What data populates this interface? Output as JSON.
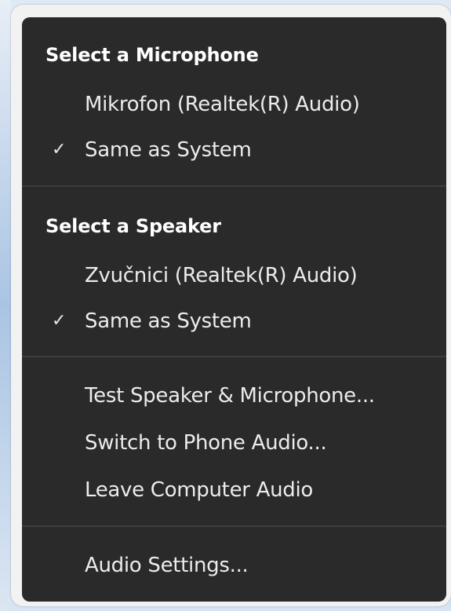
{
  "microphone_section": {
    "header": "Select a Microphone",
    "items": [
      {
        "label": "Mikrofon (Realtek(R) Audio)",
        "checked": false
      },
      {
        "label": "Same as System",
        "checked": true
      }
    ]
  },
  "speaker_section": {
    "header": "Select a Speaker",
    "items": [
      {
        "label": "Zvučnici (Realtek(R) Audio)",
        "checked": false
      },
      {
        "label": "Same as System",
        "checked": true
      }
    ]
  },
  "actions": {
    "test": "Test Speaker & Microphone...",
    "switch_phone": "Switch to Phone Audio...",
    "leave": "Leave Computer Audio"
  },
  "settings": {
    "audio_settings": "Audio Settings..."
  },
  "icons": {
    "check": "✓"
  },
  "colors": {
    "menu_background": "#2a2a2a",
    "divider": "#3d3d3d",
    "text": "#ececec"
  }
}
